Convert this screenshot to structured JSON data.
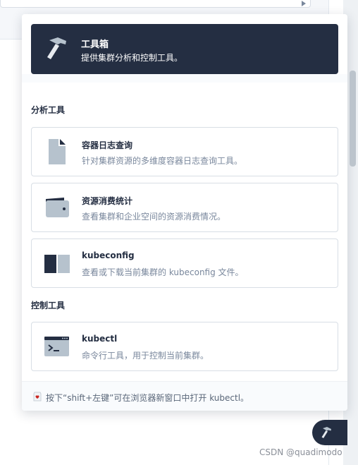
{
  "hero": {
    "title": "工具箱",
    "description": "提供集群分析和控制工具。",
    "icon": "hammer-icon"
  },
  "sections": {
    "analysis_title": "分析工具",
    "control_title": "控制工具"
  },
  "tools": {
    "container_logs": {
      "title": "容器日志查询",
      "description": "针对集群资源的多维度容器日志查询工具。",
      "icon": "document-icon"
    },
    "resource_billing": {
      "title": "资源消费统计",
      "description": "查看集群和企业空间的资源消费情况。",
      "icon": "wallet-icon"
    },
    "kubeconfig": {
      "title": "kubeconfig",
      "description": "查看或下载当前集群的 kubeconfig 文件。",
      "icon": "book-icon"
    },
    "kubectl": {
      "title": "kubectl",
      "description": "命令行工具，用于控制当前集群。",
      "icon": "terminal-icon"
    }
  },
  "footer": {
    "tip": "按下“shift+左键”可在浏览器新窗口中打开 kubectl。",
    "icon": "tip-icon"
  },
  "watermark": "CSDN @quadimodo",
  "colors": {
    "dark": "#242e42",
    "text_secondary": "#79879c",
    "border": "#d8dee5",
    "icon_muted": "#b6c2cd"
  }
}
